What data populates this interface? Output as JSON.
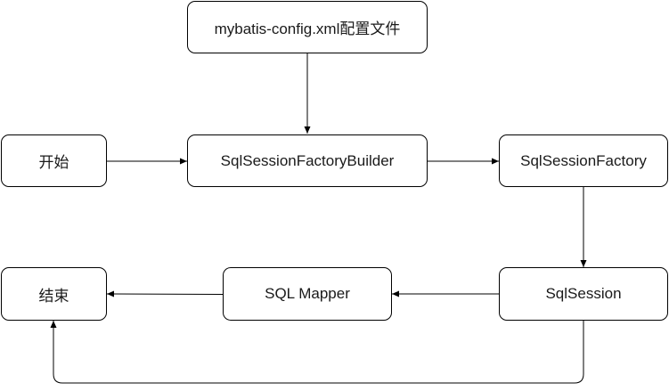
{
  "diagram": {
    "nodes": [
      {
        "id": "config",
        "label": "mybatis-config.xml配置文件"
      },
      {
        "id": "start",
        "label": "开始"
      },
      {
        "id": "builder",
        "label": "SqlSessionFactoryBuilder"
      },
      {
        "id": "factory",
        "label": "SqlSessionFactory"
      },
      {
        "id": "end",
        "label": "结束"
      },
      {
        "id": "mapper",
        "label": "SQL Mapper"
      },
      {
        "id": "session",
        "label": "SqlSession"
      }
    ],
    "edges": [
      {
        "from": "config",
        "to": "builder"
      },
      {
        "from": "start",
        "to": "builder"
      },
      {
        "from": "builder",
        "to": "factory"
      },
      {
        "from": "factory",
        "to": "session"
      },
      {
        "from": "session",
        "to": "mapper"
      },
      {
        "from": "mapper",
        "to": "end"
      },
      {
        "from": "session",
        "to": "end"
      }
    ],
    "line_color": "#000000"
  }
}
